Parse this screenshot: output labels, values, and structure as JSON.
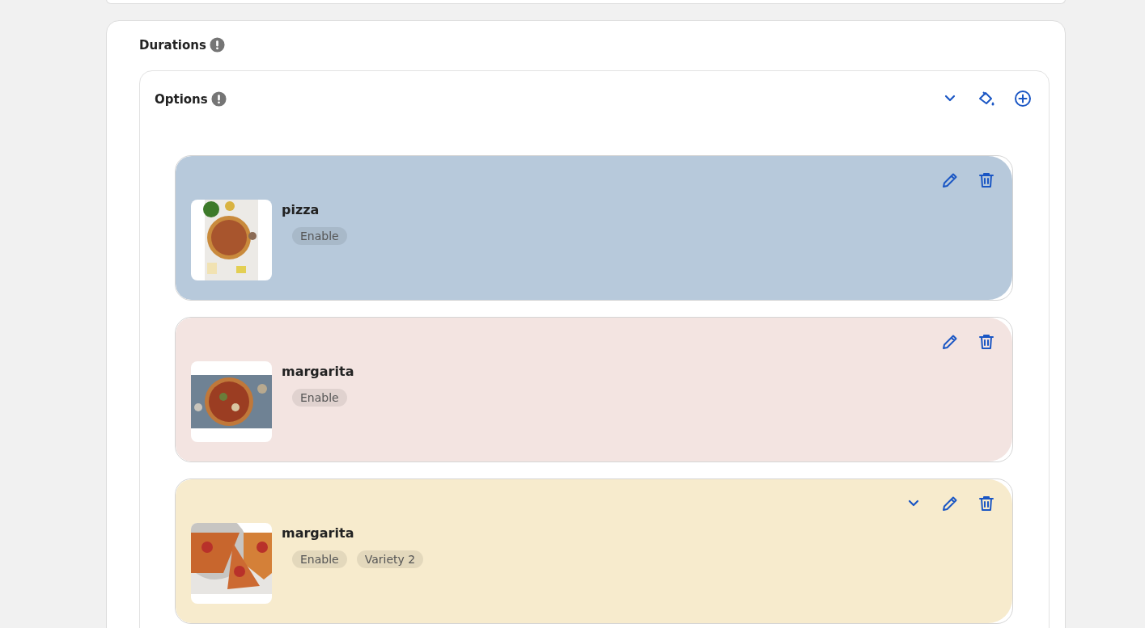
{
  "section": {
    "title": "Durations",
    "options": {
      "title": "Options",
      "items": [
        {
          "name": "pizza",
          "color": "#b7c9db",
          "expandable": false,
          "tags": [
            "Enable"
          ],
          "image": {
            "kind": "picture"
          }
        },
        {
          "name": "margarita",
          "color": "#f3e4e1",
          "expandable": false,
          "tags": [
            "Enable"
          ],
          "image": {
            "kind": "picture"
          }
        },
        {
          "name": "margarita",
          "color": "#f7ebcd",
          "expandable": true,
          "tags": [
            "Enable",
            "Variety 2"
          ],
          "image": {
            "kind": "picture"
          }
        }
      ]
    }
  }
}
